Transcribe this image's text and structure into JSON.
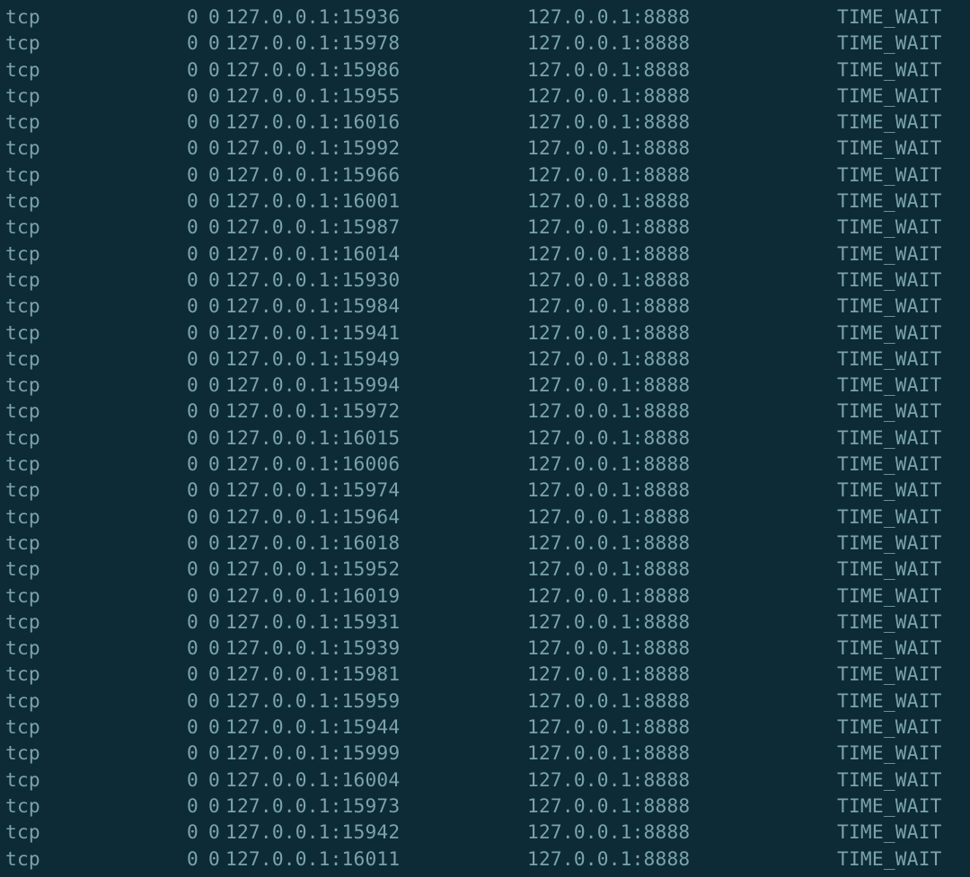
{
  "colors": {
    "background": "#0d2b36",
    "foreground": "#7aa3ad"
  },
  "connections": [
    {
      "proto": "tcp",
      "recvq": "0",
      "sendq": "0",
      "local": "127.0.0.1:15936",
      "peer": "127.0.0.1:8888",
      "state": "TIME_WAIT"
    },
    {
      "proto": "tcp",
      "recvq": "0",
      "sendq": "0",
      "local": "127.0.0.1:15978",
      "peer": "127.0.0.1:8888",
      "state": "TIME_WAIT"
    },
    {
      "proto": "tcp",
      "recvq": "0",
      "sendq": "0",
      "local": "127.0.0.1:15986",
      "peer": "127.0.0.1:8888",
      "state": "TIME_WAIT"
    },
    {
      "proto": "tcp",
      "recvq": "0",
      "sendq": "0",
      "local": "127.0.0.1:15955",
      "peer": "127.0.0.1:8888",
      "state": "TIME_WAIT"
    },
    {
      "proto": "tcp",
      "recvq": "0",
      "sendq": "0",
      "local": "127.0.0.1:16016",
      "peer": "127.0.0.1:8888",
      "state": "TIME_WAIT"
    },
    {
      "proto": "tcp",
      "recvq": "0",
      "sendq": "0",
      "local": "127.0.0.1:15992",
      "peer": "127.0.0.1:8888",
      "state": "TIME_WAIT"
    },
    {
      "proto": "tcp",
      "recvq": "0",
      "sendq": "0",
      "local": "127.0.0.1:15966",
      "peer": "127.0.0.1:8888",
      "state": "TIME_WAIT"
    },
    {
      "proto": "tcp",
      "recvq": "0",
      "sendq": "0",
      "local": "127.0.0.1:16001",
      "peer": "127.0.0.1:8888",
      "state": "TIME_WAIT"
    },
    {
      "proto": "tcp",
      "recvq": "0",
      "sendq": "0",
      "local": "127.0.0.1:15987",
      "peer": "127.0.0.1:8888",
      "state": "TIME_WAIT"
    },
    {
      "proto": "tcp",
      "recvq": "0",
      "sendq": "0",
      "local": "127.0.0.1:16014",
      "peer": "127.0.0.1:8888",
      "state": "TIME_WAIT"
    },
    {
      "proto": "tcp",
      "recvq": "0",
      "sendq": "0",
      "local": "127.0.0.1:15930",
      "peer": "127.0.0.1:8888",
      "state": "TIME_WAIT"
    },
    {
      "proto": "tcp",
      "recvq": "0",
      "sendq": "0",
      "local": "127.0.0.1:15984",
      "peer": "127.0.0.1:8888",
      "state": "TIME_WAIT"
    },
    {
      "proto": "tcp",
      "recvq": "0",
      "sendq": "0",
      "local": "127.0.0.1:15941",
      "peer": "127.0.0.1:8888",
      "state": "TIME_WAIT"
    },
    {
      "proto": "tcp",
      "recvq": "0",
      "sendq": "0",
      "local": "127.0.0.1:15949",
      "peer": "127.0.0.1:8888",
      "state": "TIME_WAIT"
    },
    {
      "proto": "tcp",
      "recvq": "0",
      "sendq": "0",
      "local": "127.0.0.1:15994",
      "peer": "127.0.0.1:8888",
      "state": "TIME_WAIT"
    },
    {
      "proto": "tcp",
      "recvq": "0",
      "sendq": "0",
      "local": "127.0.0.1:15972",
      "peer": "127.0.0.1:8888",
      "state": "TIME_WAIT"
    },
    {
      "proto": "tcp",
      "recvq": "0",
      "sendq": "0",
      "local": "127.0.0.1:16015",
      "peer": "127.0.0.1:8888",
      "state": "TIME_WAIT"
    },
    {
      "proto": "tcp",
      "recvq": "0",
      "sendq": "0",
      "local": "127.0.0.1:16006",
      "peer": "127.0.0.1:8888",
      "state": "TIME_WAIT"
    },
    {
      "proto": "tcp",
      "recvq": "0",
      "sendq": "0",
      "local": "127.0.0.1:15974",
      "peer": "127.0.0.1:8888",
      "state": "TIME_WAIT"
    },
    {
      "proto": "tcp",
      "recvq": "0",
      "sendq": "0",
      "local": "127.0.0.1:15964",
      "peer": "127.0.0.1:8888",
      "state": "TIME_WAIT"
    },
    {
      "proto": "tcp",
      "recvq": "0",
      "sendq": "0",
      "local": "127.0.0.1:16018",
      "peer": "127.0.0.1:8888",
      "state": "TIME_WAIT"
    },
    {
      "proto": "tcp",
      "recvq": "0",
      "sendq": "0",
      "local": "127.0.0.1:15952",
      "peer": "127.0.0.1:8888",
      "state": "TIME_WAIT"
    },
    {
      "proto": "tcp",
      "recvq": "0",
      "sendq": "0",
      "local": "127.0.0.1:16019",
      "peer": "127.0.0.1:8888",
      "state": "TIME_WAIT"
    },
    {
      "proto": "tcp",
      "recvq": "0",
      "sendq": "0",
      "local": "127.0.0.1:15931",
      "peer": "127.0.0.1:8888",
      "state": "TIME_WAIT"
    },
    {
      "proto": "tcp",
      "recvq": "0",
      "sendq": "0",
      "local": "127.0.0.1:15939",
      "peer": "127.0.0.1:8888",
      "state": "TIME_WAIT"
    },
    {
      "proto": "tcp",
      "recvq": "0",
      "sendq": "0",
      "local": "127.0.0.1:15981",
      "peer": "127.0.0.1:8888",
      "state": "TIME_WAIT"
    },
    {
      "proto": "tcp",
      "recvq": "0",
      "sendq": "0",
      "local": "127.0.0.1:15959",
      "peer": "127.0.0.1:8888",
      "state": "TIME_WAIT"
    },
    {
      "proto": "tcp",
      "recvq": "0",
      "sendq": "0",
      "local": "127.0.0.1:15944",
      "peer": "127.0.0.1:8888",
      "state": "TIME_WAIT"
    },
    {
      "proto": "tcp",
      "recvq": "0",
      "sendq": "0",
      "local": "127.0.0.1:15999",
      "peer": "127.0.0.1:8888",
      "state": "TIME_WAIT"
    },
    {
      "proto": "tcp",
      "recvq": "0",
      "sendq": "0",
      "local": "127.0.0.1:16004",
      "peer": "127.0.0.1:8888",
      "state": "TIME_WAIT"
    },
    {
      "proto": "tcp",
      "recvq": "0",
      "sendq": "0",
      "local": "127.0.0.1:15973",
      "peer": "127.0.0.1:8888",
      "state": "TIME_WAIT"
    },
    {
      "proto": "tcp",
      "recvq": "0",
      "sendq": "0",
      "local": "127.0.0.1:15942",
      "peer": "127.0.0.1:8888",
      "state": "TIME_WAIT"
    },
    {
      "proto": "tcp",
      "recvq": "0",
      "sendq": "0",
      "local": "127.0.0.1:16011",
      "peer": "127.0.0.1:8888",
      "state": "TIME_WAIT"
    }
  ]
}
